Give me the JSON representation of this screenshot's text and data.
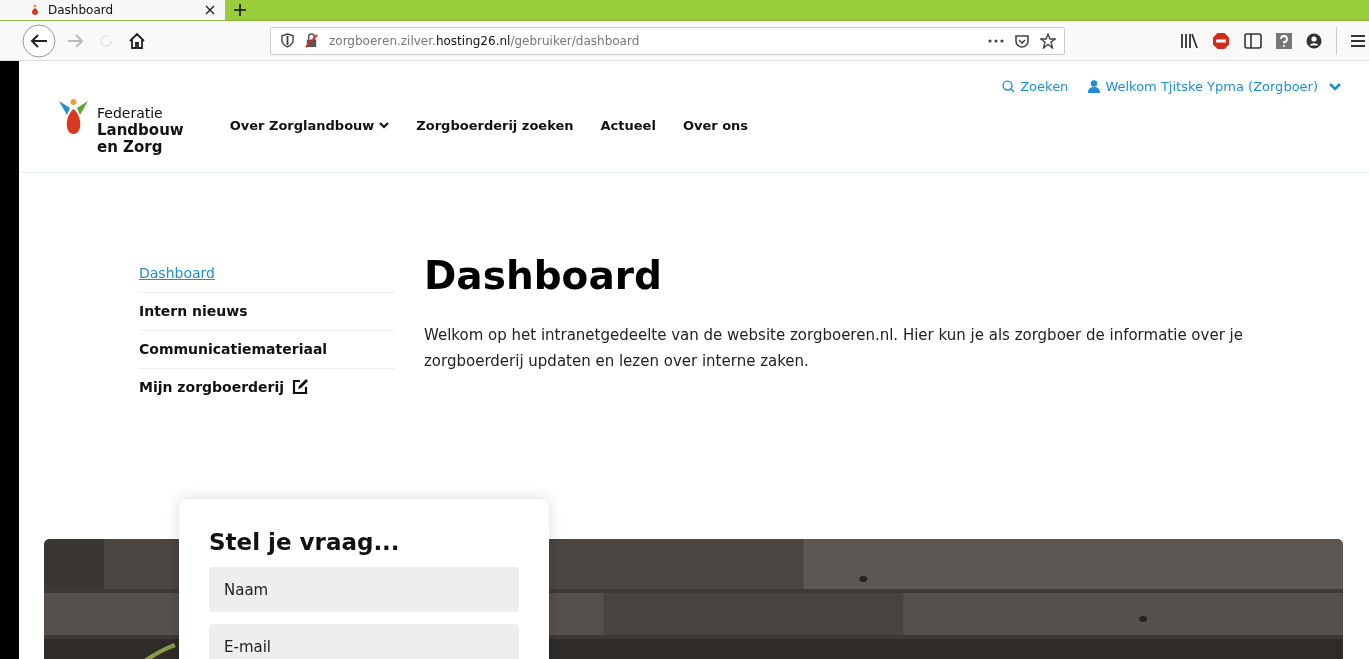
{
  "browser": {
    "tab": {
      "title": "Dashboard",
      "selected": true
    },
    "url": {
      "host_prefix": "zorgboeren.zilver.",
      "host": "hosting26.nl",
      "path": "/gebruiker/dashboard"
    }
  },
  "header": {
    "logo": {
      "line1": "Federatie",
      "line2": "Landbouw",
      "line3": "en Zorg"
    },
    "nav": [
      {
        "label": "Over Zorglandbouw",
        "dropdown": true
      },
      {
        "label": "Zorgboerderij zoeken",
        "dropdown": false
      },
      {
        "label": "Actueel",
        "dropdown": false
      },
      {
        "label": "Over ons",
        "dropdown": false
      }
    ],
    "search": "Zoeken",
    "user": "Welkom Tjitske Ypma (Zorgboer)"
  },
  "sidebar": {
    "items": [
      {
        "label": "Dashboard",
        "selected": true,
        "external": false
      },
      {
        "label": "Intern nieuws",
        "selected": false,
        "external": false
      },
      {
        "label": "Communicatiemateriaal",
        "selected": false,
        "external": false
      },
      {
        "label": "Mijn zorgboerderij",
        "selected": false,
        "external": true
      }
    ]
  },
  "main": {
    "title": "Dashboard",
    "intro": "Welkom op het intranetgedeelte van de website zorgboeren.nl. Hier kun je als zorgboer de informatie over je zorgboerderij updaten en lezen over interne zaken."
  },
  "form": {
    "title": "Stel je vraag...",
    "fields": [
      {
        "placeholder": "Naam"
      },
      {
        "placeholder": "E-mail"
      }
    ]
  }
}
